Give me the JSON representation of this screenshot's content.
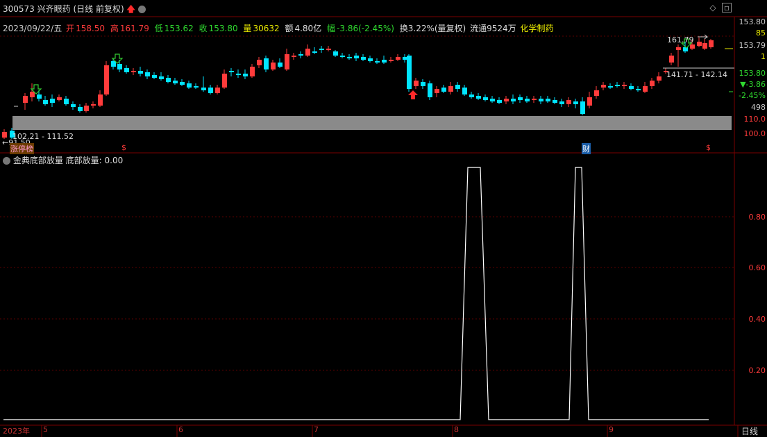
{
  "header": {
    "code": "300573",
    "name": "兴齐眼药",
    "mode": "(日线 前复权)"
  },
  "quote": {
    "date": "2023/09/22/五",
    "open_label": "开",
    "open": "158.50",
    "high_label": "高",
    "high": "161.79",
    "low_label": "低",
    "low": "153.62",
    "close_label": "收",
    "close": "153.80",
    "vol_label": "量",
    "vol": "30632",
    "amount_label": "额",
    "amount": "4.80亿",
    "change_label": "幅",
    "change": "-3.86(-2.45%)",
    "turnover": "换3.22%(量复权)",
    "float": "流通9524万",
    "sector": "化学制药"
  },
  "price_axis": {
    "labels": [
      "153.80",
      "85",
      "153.79",
      "1",
      "153.80",
      "▼-3.86",
      "-2.45%",
      "498",
      "110.0",
      "100.0"
    ]
  },
  "annotations": {
    "high_mark": "161.79",
    "range_right": "141.71 - 142.14",
    "range_left": "102.21 - 111.52",
    "low_mark": "←91.50",
    "zhangting": "涨停榜",
    "dollar1": "$",
    "dollar2": "$",
    "cai": "财"
  },
  "indicator": {
    "name": "金典底部放量",
    "value_text": "底部放量: 0.00",
    "axis": [
      "0.80",
      "0.60",
      "0.40",
      "0.20"
    ]
  },
  "xaxis": {
    "labels": [
      "2023年",
      "5",
      "6",
      "7",
      "8",
      "9"
    ],
    "period_tab": "日线"
  },
  "colors": {
    "up": "#ff3b3b",
    "down": "#00e5ff",
    "grid": "#5a0000",
    "line": "#ffffff"
  }
}
